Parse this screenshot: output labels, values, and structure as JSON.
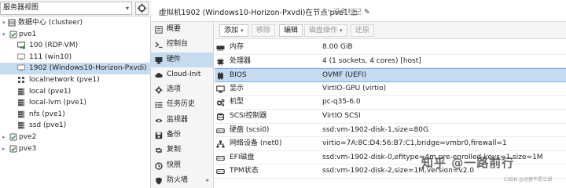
{
  "view_selector": {
    "label": "服务器视图"
  },
  "tree": {
    "datacenter": "数据中心 (clusteer)",
    "nodes": [
      {
        "label": "pve1"
      },
      {
        "label": "100 (RDP-VM)"
      },
      {
        "label": "111 (win10)"
      },
      {
        "label": "1902 (Windows10-Horizon-Pxvdi)"
      },
      {
        "label": "localnetwork (pve1)"
      },
      {
        "label": "local (pve1)"
      },
      {
        "label": "local-lvm (pve1)"
      },
      {
        "label": "nfs (pve1)"
      },
      {
        "label": "ssd (pve1)"
      },
      {
        "label": "pve2"
      },
      {
        "label": "pve3"
      }
    ]
  },
  "header": {
    "title": "虚拟机1902 (Windows10-Horizon-Pxvdi)在节点'pve1'上",
    "tags": "没有标记"
  },
  "nav": [
    {
      "label": "概要",
      "icon": "summary-icon"
    },
    {
      "label": "控制台",
      "icon": "console-icon"
    },
    {
      "label": "硬件",
      "icon": "monitor-icon"
    },
    {
      "label": "Cloud-Init",
      "icon": "cloud-icon"
    },
    {
      "label": "选项",
      "icon": "gear-icon"
    },
    {
      "label": "任务历史",
      "icon": "list-icon"
    },
    {
      "label": "监视器",
      "icon": "eye-icon"
    },
    {
      "label": "备份",
      "icon": "floppy-icon"
    },
    {
      "label": "复制",
      "icon": "retweet-icon"
    },
    {
      "label": "快照",
      "icon": "history-icon"
    },
    {
      "label": "防火墙",
      "icon": "shield-icon"
    }
  ],
  "toolbar": {
    "add": "添加",
    "remove": "移除",
    "edit": "编辑",
    "disk_action": "磁盘操作",
    "revert": "还原"
  },
  "hardware": [
    {
      "key": "内存",
      "value": "8.00 GiB",
      "icon": "memory-icon"
    },
    {
      "key": "处理器",
      "value": "4 (1 sockets, 4 cores) [host]",
      "icon": "cpu-icon"
    },
    {
      "key": "BIOS",
      "value": "OVMF (UEFI)",
      "icon": "chip-icon"
    },
    {
      "key": "显示",
      "value": "VirtIO-GPU (virtio)",
      "icon": "display-icon"
    },
    {
      "key": "机型",
      "value": "pc-q35-6.0",
      "icon": "cogs-icon"
    },
    {
      "key": "SCSI控制器",
      "value": "VirtIO SCSI",
      "icon": "database-icon"
    },
    {
      "key": "硬盘 (scsi0)",
      "value": "ssd:vm-1902-disk-1,size=80G",
      "icon": "harddisk-icon"
    },
    {
      "key": "网络设备 (net0)",
      "value": "virtio=7A:8C:D4:56:B7:C1,bridge=vmbr0,firewall=1",
      "icon": "network-icon"
    },
    {
      "key": "EFI磁盘",
      "value": "ssd:vm-1902-disk-0,efitype=4m,pre-enrolled-keys=1,size=1M",
      "icon": "harddisk-icon"
    },
    {
      "key": "TPM状态",
      "value": "ssd:vm-1902-disk-2,size=1M,version=v2.0",
      "icon": "harddisk-icon"
    }
  ],
  "watermark": {
    "main": "知乎 @一路前行",
    "small": "CSDN @运营不是江湖"
  },
  "colors": {
    "selection": "#c5dbf0",
    "selection_border": "#7eb0e0",
    "vm_running": "#2e9e3c",
    "vm_stopped": "#8a8a8a"
  }
}
